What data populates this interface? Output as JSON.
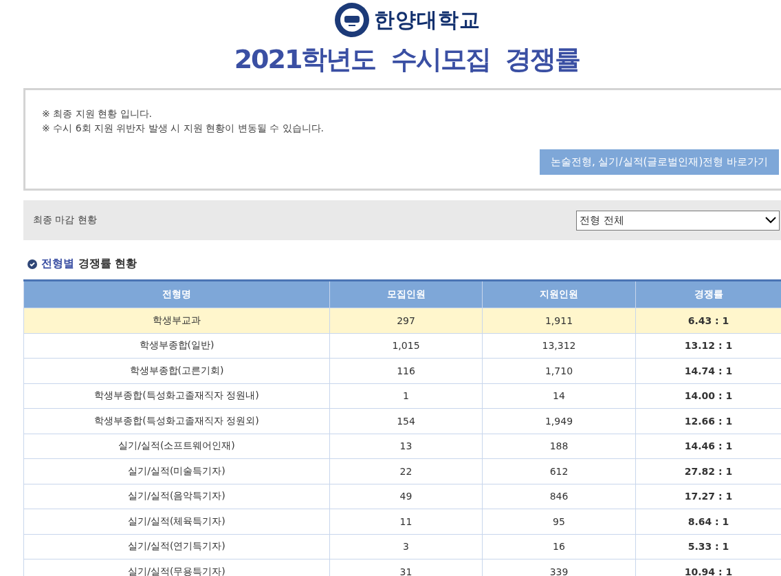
{
  "header": {
    "university": "한양대학교",
    "title": "2021학년도  수시모집  경쟁률"
  },
  "notice": {
    "lines": [
      "※ 최종 지원 현황 입니다.",
      "※ 수시 6회 지원 위반자 발생 시 지원 현황이 변동될 수 있습니다."
    ],
    "button": "논술전형, 실기/실적(글로벌인재)전형 바로가기"
  },
  "filter_bar": {
    "label": "최종 마감 현황",
    "select": "전형 전체"
  },
  "section": {
    "title_highlight": "전형별",
    "title_rest": "경쟁률 현황"
  },
  "table": {
    "columns": [
      "전형명",
      "모집인원",
      "지원인원",
      "경쟁률"
    ],
    "rows": [
      {
        "cells": [
          "학생부교과",
          "297",
          "1,911",
          "6.43 : 1"
        ],
        "highlighted": true
      },
      {
        "cells": [
          "학생부종합(일반)",
          "1,015",
          "13,312",
          "13.12 : 1"
        ],
        "highlighted": false
      },
      {
        "cells": [
          "학생부종합(고른기회)",
          "116",
          "1,710",
          "14.74 : 1"
        ],
        "highlighted": false
      },
      {
        "cells": [
          "학생부종합(특성화고졸재직자 정원내)",
          "1",
          "14",
          "14.00 : 1"
        ],
        "highlighted": false
      },
      {
        "cells": [
          "학생부종합(특성화고졸재직자 정원외)",
          "154",
          "1,949",
          "12.66 : 1"
        ],
        "highlighted": false
      },
      {
        "cells": [
          "실기/실적(소프트웨어인재)",
          "13",
          "188",
          "14.46 : 1"
        ],
        "highlighted": false
      },
      {
        "cells": [
          "실기/실적(미술특기자)",
          "22",
          "612",
          "27.82 : 1"
        ],
        "highlighted": false
      },
      {
        "cells": [
          "실기/실적(음악특기자)",
          "49",
          "846",
          "17.27 : 1"
        ],
        "highlighted": false
      },
      {
        "cells": [
          "실기/실적(체육특기자)",
          "11",
          "95",
          "8.64 : 1"
        ],
        "highlighted": false
      },
      {
        "cells": [
          "실기/실적(연기특기자)",
          "3",
          "16",
          "5.33 : 1"
        ],
        "highlighted": false
      },
      {
        "cells": [
          "실기/실적(무용특기자)",
          "31",
          "339",
          "10.94 : 1"
        ],
        "highlighted": false
      }
    ]
  }
}
